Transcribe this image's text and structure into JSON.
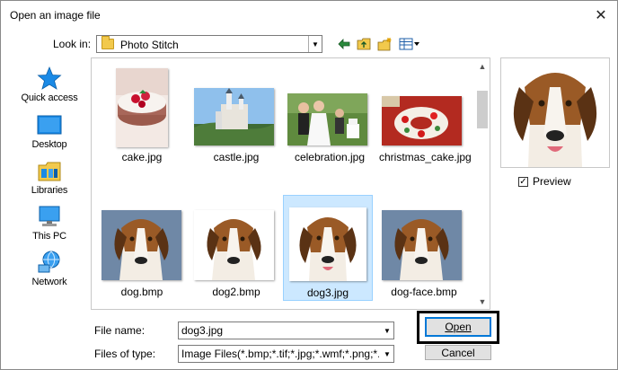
{
  "window": {
    "title": "Open an image file",
    "close_glyph": "✕"
  },
  "toolbar": {
    "look_in_label": "Look in:",
    "look_in_value": "Photo Stitch",
    "icons": [
      "back-arrow-icon",
      "up-folder-icon",
      "new-folder-icon",
      "view-menu-icon"
    ]
  },
  "places": [
    {
      "label": "Quick access",
      "icon": "star-icon"
    },
    {
      "label": "Desktop",
      "icon": "desktop-icon"
    },
    {
      "label": "Libraries",
      "icon": "libraries-icon"
    },
    {
      "label": "This PC",
      "icon": "computer-icon"
    },
    {
      "label": "Network",
      "icon": "network-icon"
    }
  ],
  "files": [
    {
      "name": "cake.jpg"
    },
    {
      "name": "castle.jpg"
    },
    {
      "name": "celebration.jpg"
    },
    {
      "name": "christmas_cake.jpg"
    },
    {
      "name": "dog.bmp"
    },
    {
      "name": "dog2.bmp"
    },
    {
      "name": "dog3.jpg",
      "selected": true
    },
    {
      "name": "dog-face.bmp"
    }
  ],
  "preview": {
    "label": "Preview",
    "checked": true,
    "check_glyph": "✓"
  },
  "form": {
    "file_name_label": "File name:",
    "file_name_value": "dog3.jpg",
    "files_of_type_label": "Files of type:",
    "files_of_type_value": "Image Files(*.bmp;*.tif;*.jpg;*.wmf;*.png;*.eps;*.gif)"
  },
  "buttons": {
    "open_label": "Open",
    "cancel_label": "Cancel"
  },
  "colors": {
    "selection_bg": "#cce8ff",
    "selection_border": "#99d1ff",
    "accent": "#0078d7",
    "folder": "#f2c94c"
  }
}
